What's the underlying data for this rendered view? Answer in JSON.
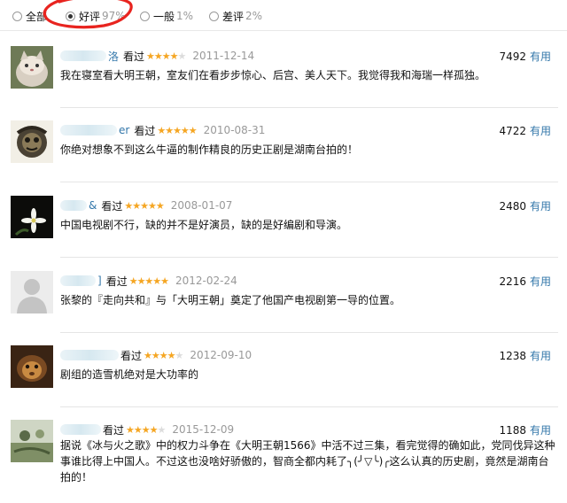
{
  "filters": [
    {
      "label": "全部",
      "pct": "",
      "checked": false
    },
    {
      "label": "好评",
      "pct": "97%",
      "checked": true
    },
    {
      "label": "一般",
      "pct": "1%",
      "checked": false
    },
    {
      "label": "差评",
      "pct": "2%",
      "checked": false
    }
  ],
  "reviews": [
    {
      "name_visible": "洛",
      "seen": "看过",
      "stars": 4,
      "date": "2011-12-14",
      "votes": "7492",
      "useful": "有用",
      "text": "我在寝室看大明王朝，室友们在看步步惊心、后宫、美人天下。我觉得我和海瑞一样孤独。"
    },
    {
      "name_visible": "er",
      "seen": "看过",
      "stars": 5,
      "date": "2010-08-31",
      "votes": "4722",
      "useful": "有用",
      "text": "你绝对想象不到这么牛逼的制作精良的历史正剧是湖南台拍的！"
    },
    {
      "name_visible": "&",
      "seen": "看过",
      "stars": 5,
      "date": "2008-01-07",
      "votes": "2480",
      "useful": "有用",
      "text": "中国电视剧不行，缺的并不是好演员，缺的是好编剧和导演。"
    },
    {
      "name_visible": "]",
      "seen": "看过",
      "stars": 5,
      "date": "2012-02-24",
      "votes": "2216",
      "useful": "有用",
      "text": "张黎的『走向共和』与「大明王朝」奠定了他国产电视剧第一导的位置。"
    },
    {
      "name_visible": "",
      "seen": "看过",
      "stars": 4,
      "date": "2012-09-10",
      "votes": "1238",
      "useful": "有用",
      "text": "剧组的造雪机绝对是大功率的"
    },
    {
      "name_visible": "",
      "seen": "看过",
      "stars": 4,
      "date": "2015-12-09",
      "votes": "1188",
      "useful": "有用",
      "text": "据说《冰与火之歌》中的权力斗争在《大明王朝1566》中活不过三集，看完觉得的确如此，党同伐异这种事谁比得上中国人。不过这也没啥好骄傲的，智商全都内耗了╮(╯▽╰)╭这么认真的历史剧，竟然是湖南台拍的！"
    }
  ],
  "colors": {
    "star": "#f5a623",
    "link": "#3377aa",
    "annotation": "#e8241f"
  }
}
